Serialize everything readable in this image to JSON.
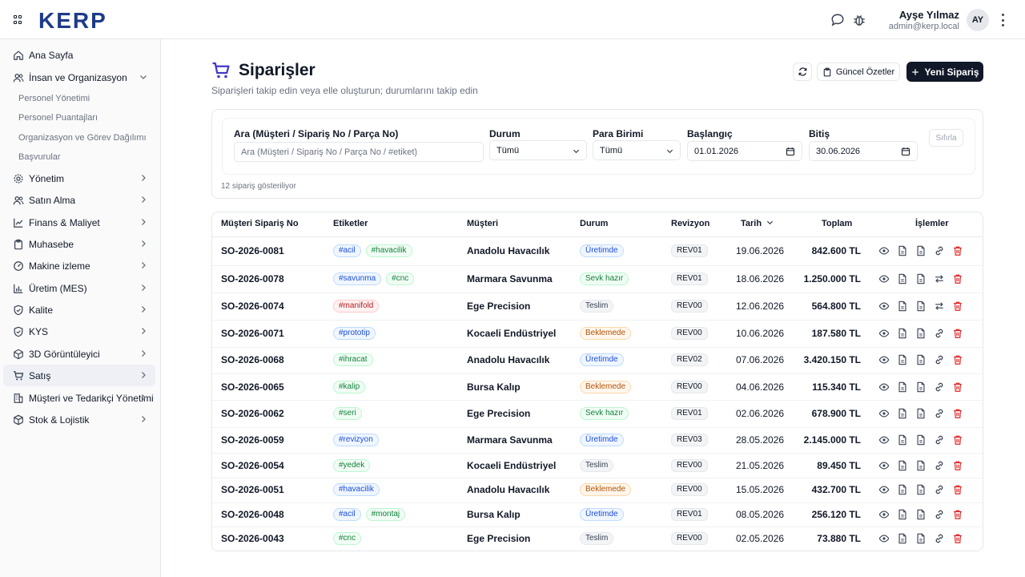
{
  "header": {
    "logo": "KERP",
    "user_name": "Ayşe Yılmaz",
    "user_email": "admin@kerp.local",
    "avatar_initials": "AY"
  },
  "sidebar": {
    "items": [
      {
        "label": "Ana Sayfa",
        "icon": "home-icon"
      },
      {
        "label": "İnsan ve Organizasyon",
        "icon": "users-icon",
        "expanded": true,
        "children": [
          "Personel Yönetimi",
          "Personel Puantajları",
          "Organizasyon ve Görev Dağılımı",
          "Başvurular"
        ]
      },
      {
        "label": "Yönetim",
        "icon": "gear-icon"
      },
      {
        "label": "Satın Alma",
        "icon": "users-icon"
      },
      {
        "label": "Finans & Maliyet",
        "icon": "chart-icon"
      },
      {
        "label": "Muhasebe",
        "icon": "clipboard-icon"
      },
      {
        "label": "Makine izleme",
        "icon": "gauge-icon"
      },
      {
        "label": "Üretim (MES)",
        "icon": "bar-chart-icon"
      },
      {
        "label": "Kalite",
        "icon": "shield-icon"
      },
      {
        "label": "KYS",
        "icon": "shield-icon"
      },
      {
        "label": "3D Görüntüleyici",
        "icon": "cube-icon"
      },
      {
        "label": "Satış",
        "icon": "cart-icon",
        "active": true
      },
      {
        "label": "Müşteri ve Tedarikçi Yönetimi",
        "icon": "building-icon"
      },
      {
        "label": "Stok & Lojistik",
        "icon": "box-icon"
      }
    ]
  },
  "page": {
    "title": "Siparişler",
    "subtitle": "Siparişleri takip edin veya elle oluşturun; durumlarını takip edin",
    "summary_button": "Güncel Özetler",
    "new_button": "Yeni Sipariş"
  },
  "filters": {
    "search_label": "Ara (Müşteri / Sipariş No / Parça No)",
    "search_placeholder": "Ara (Müşteri / Sipariş No / Parça No / #etiket)",
    "status_label": "Durum",
    "status_value": "Tümü",
    "currency_label": "Para Birimi",
    "currency_value": "Tümü",
    "start_label": "Başlangıç",
    "start_value": "01.01.2026",
    "end_label": "Bitiş",
    "end_value": "30.06.2026",
    "reset_button": "Sıfırla",
    "count_text": "12 sipariş gösteriliyor"
  },
  "table": {
    "columns": [
      "Müşteri Sipariş No",
      "Etiketler",
      "Müşteri",
      "Durum",
      "Revizyon",
      "Tarih",
      "Toplam",
      "İşlemler"
    ],
    "rows": [
      {
        "no": "SO-2026-0081",
        "tags": [
          {
            "t": "#acil",
            "c": "blue"
          },
          {
            "t": "#havacilik",
            "c": "green"
          }
        ],
        "customer": "Anadolu Havacılık",
        "status": "Üretimde",
        "sc": "uretim",
        "rev": "REV01",
        "date": "19.06.2026",
        "total": "842.600 TL",
        "action4": "link"
      },
      {
        "no": "SO-2026-0078",
        "tags": [
          {
            "t": "#savunma",
            "c": "blue"
          },
          {
            "t": "#cnc",
            "c": "green"
          }
        ],
        "customer": "Marmara Savunma",
        "status": "Sevk hazır",
        "sc": "sevk",
        "rev": "REV01",
        "date": "18.06.2026",
        "total": "1.250.000 TL",
        "action4": "swap"
      },
      {
        "no": "SO-2026-0074",
        "tags": [
          {
            "t": "#manifold",
            "c": "red"
          }
        ],
        "customer": "Ege Precision",
        "status": "Teslim",
        "sc": "teslim",
        "rev": "REV00",
        "date": "12.06.2026",
        "total": "564.800 TL",
        "action4": "swap"
      },
      {
        "no": "SO-2026-0071",
        "tags": [
          {
            "t": "#prototip",
            "c": "blue"
          }
        ],
        "customer": "Kocaeli Endüstriyel",
        "status": "Beklemede",
        "sc": "bekle",
        "rev": "REV00",
        "date": "10.06.2026",
        "total": "187.580 TL",
        "action4": "link"
      },
      {
        "no": "SO-2026-0068",
        "tags": [
          {
            "t": "#ihracat",
            "c": "green"
          }
        ],
        "customer": "Anadolu Havacılık",
        "status": "Üretimde",
        "sc": "uretim",
        "rev": "REV02",
        "date": "07.06.2026",
        "total": "3.420.150 TL",
        "action4": "link"
      },
      {
        "no": "SO-2026-0065",
        "tags": [
          {
            "t": "#kalip",
            "c": "green"
          }
        ],
        "customer": "Bursa Kalıp",
        "status": "Beklemede",
        "sc": "bekle",
        "rev": "REV00",
        "date": "04.06.2026",
        "total": "115.340 TL",
        "action4": "link"
      },
      {
        "no": "SO-2026-0062",
        "tags": [
          {
            "t": "#seri",
            "c": "green"
          }
        ],
        "customer": "Ege Precision",
        "status": "Sevk hazır",
        "sc": "sevk",
        "rev": "REV01",
        "date": "02.06.2026",
        "total": "678.900 TL",
        "action4": "link"
      },
      {
        "no": "SO-2026-0059",
        "tags": [
          {
            "t": "#revizyon",
            "c": "blue"
          }
        ],
        "customer": "Marmara Savunma",
        "status": "Üretimde",
        "sc": "uretim",
        "rev": "REV03",
        "date": "28.05.2026",
        "total": "2.145.000 TL",
        "action4": "link"
      },
      {
        "no": "SO-2026-0054",
        "tags": [
          {
            "t": "#yedek",
            "c": "green"
          }
        ],
        "customer": "Kocaeli Endüstriyel",
        "status": "Teslim",
        "sc": "teslim",
        "rev": "REV00",
        "date": "21.05.2026",
        "total": "89.450 TL",
        "action4": "link"
      },
      {
        "no": "SO-2026-0051",
        "tags": [
          {
            "t": "#havacilik",
            "c": "blue"
          }
        ],
        "customer": "Anadolu Havacılık",
        "status": "Beklemede",
        "sc": "bekle",
        "rev": "REV00",
        "date": "15.05.2026",
        "total": "432.700 TL",
        "action4": "link"
      },
      {
        "no": "SO-2026-0048",
        "tags": [
          {
            "t": "#acil",
            "c": "blue"
          },
          {
            "t": "#montaj",
            "c": "green"
          }
        ],
        "customer": "Bursa Kalıp",
        "status": "Üretimde",
        "sc": "uretim",
        "rev": "REV01",
        "date": "08.05.2026",
        "total": "256.120 TL",
        "action4": "link"
      },
      {
        "no": "SO-2026-0043",
        "tags": [
          {
            "t": "#cnc",
            "c": "green"
          }
        ],
        "customer": "Ege Precision",
        "status": "Teslim",
        "sc": "teslim",
        "rev": "REV00",
        "date": "02.05.2026",
        "total": "73.880 TL",
        "action4": "link"
      }
    ]
  }
}
